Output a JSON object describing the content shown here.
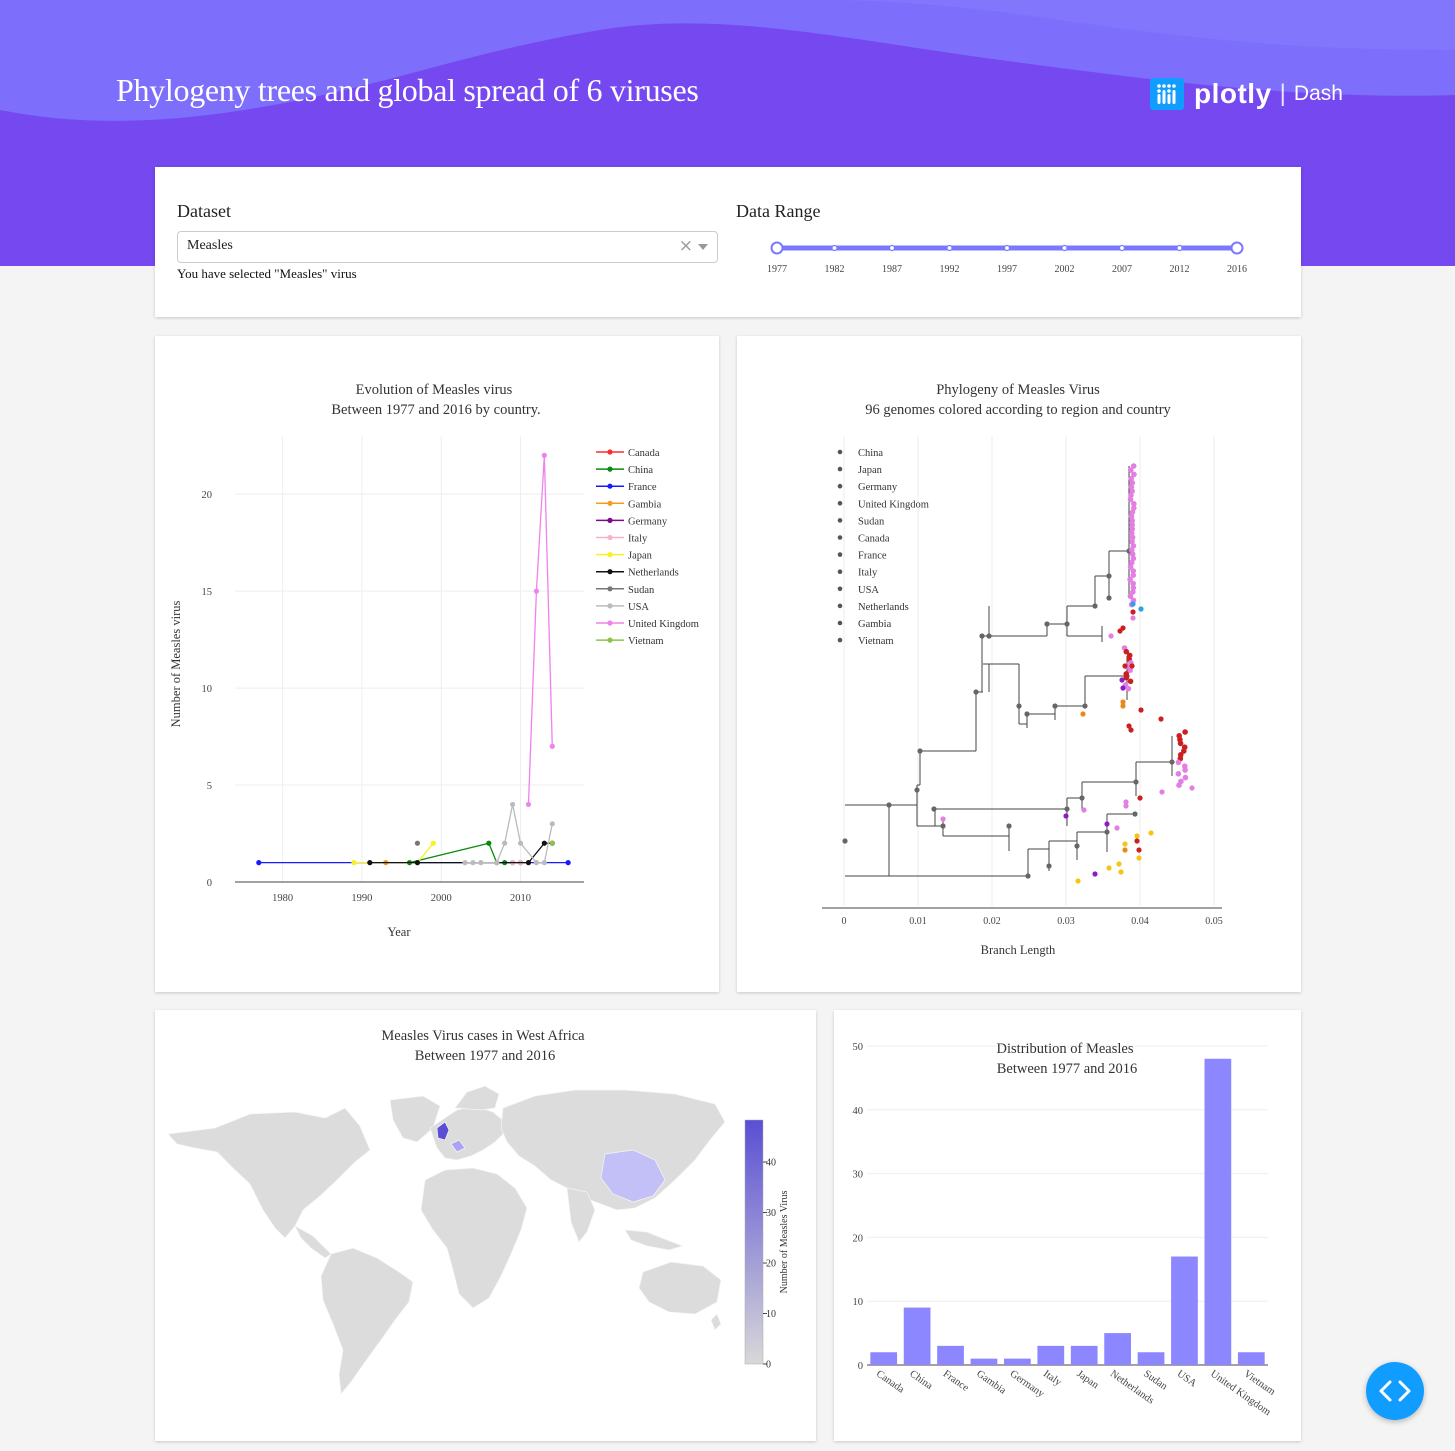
{
  "header": {
    "title": "Phylogeny trees and global spread of 6 viruses",
    "logo_word": "plotly",
    "logo_product": "Dash"
  },
  "controls": {
    "dataset_label": "Dataset",
    "dataset_value": "Measles",
    "selected_note": "You have selected \"Measles\" virus",
    "range_label": "Data Range",
    "range_marks": [
      "1977",
      "1982",
      "1987",
      "1992",
      "1997",
      "2002",
      "2007",
      "2012",
      "2016"
    ],
    "range_value": [
      "1977",
      "2016"
    ]
  },
  "colors": {
    "accent": "#7b78ff",
    "header": "#7548f0",
    "clear_icon": "#999",
    "fab": "#119dff"
  },
  "charts": {
    "evolution": {
      "title_line1": "Evolution of Measles virus",
      "title_line2": "Between 1977 and 2016 by country."
    },
    "phylogeny": {
      "title_line1": "Phylogeny of Measles Virus",
      "title_line2": "96 genomes colored according to region and country"
    },
    "map": {
      "title_line1": "Measles Virus cases in West Africa",
      "title_line2": "Between 1977 and 2016",
      "colorbar_title": "Number of Measles Virus",
      "colorbar_ticks": [
        "0",
        "10",
        "20",
        "30",
        "40"
      ]
    },
    "distribution": {
      "title_line1": "Distribution of Measles",
      "title_line2": "Between 1977 and 2016"
    }
  },
  "chart_data": [
    {
      "type": "line",
      "xlabel": "Year",
      "ylabel": "Number of Measles virus",
      "xlim": [
        1974,
        2018
      ],
      "ylim": [
        0,
        23
      ],
      "xticks": [
        1980,
        1990,
        2000,
        2010
      ],
      "yticks": [
        0,
        5,
        10,
        15,
        20
      ],
      "legend_position": "right",
      "series": [
        {
          "name": "Canada",
          "color": "#ff2a2a",
          "points": []
        },
        {
          "name": "China",
          "color": "#0a8a0a",
          "points": [
            [
              1996,
              1
            ],
            [
              2006,
              2
            ],
            [
              2007,
              1
            ],
            [
              2008,
              1
            ],
            [
              2009,
              1
            ],
            [
              2010,
              1
            ]
          ]
        },
        {
          "name": "France",
          "color": "#1a1aff",
          "points": [
            [
              1977,
              1
            ],
            [
              2016,
              1
            ]
          ]
        },
        {
          "name": "Gambia",
          "color": "#f59c1a",
          "points": [
            [
              1993,
              1
            ]
          ]
        },
        {
          "name": "Germany",
          "color": "#7a0a8a",
          "points": []
        },
        {
          "name": "Italy",
          "color": "#f6b3c6",
          "points": [
            [
              2009,
              1
            ],
            [
              2010,
              1
            ]
          ]
        },
        {
          "name": "Japan",
          "color": "#f8f020",
          "points": [
            [
              1989,
              1
            ],
            [
              1997,
              1
            ],
            [
              1999,
              2
            ]
          ]
        },
        {
          "name": "Netherlands",
          "color": "#111111",
          "points": [
            [
              1991,
              1
            ],
            [
              1997,
              1
            ],
            [
              2011,
              1
            ],
            [
              2013,
              2
            ],
            [
              2014,
              2
            ]
          ]
        },
        {
          "name": "Sudan",
          "color": "#777777",
          "points": [
            [
              1997,
              2
            ]
          ]
        },
        {
          "name": "USA",
          "color": "#bbbbbb",
          "points": [
            [
              2003,
              1
            ],
            [
              2004,
              1
            ],
            [
              2005,
              1
            ],
            [
              2007,
              1
            ],
            [
              2008,
              2
            ],
            [
              2009,
              4
            ],
            [
              2010,
              2
            ],
            [
              2012,
              1
            ],
            [
              2013,
              1
            ],
            [
              2014,
              3
            ]
          ]
        },
        {
          "name": "United Kingdom",
          "color": "#ee82ee",
          "points": [
            [
              2011,
              4
            ],
            [
              2012,
              15
            ],
            [
              2013,
              22
            ],
            [
              2014,
              7
            ]
          ]
        },
        {
          "name": "Vietnam",
          "color": "#8bc34a",
          "points": [
            [
              2014,
              2
            ]
          ]
        }
      ]
    },
    {
      "type": "scatter",
      "xlabel": "Branch Length",
      "ylabel": "",
      "xlim": [
        -0.003,
        0.05
      ],
      "xticks": [
        "0",
        "0.01",
        "0.02",
        "0.03",
        "0.04",
        "0.05"
      ],
      "legend_position": "top-left",
      "legend": [
        "China",
        "Japan",
        "Germany",
        "United Kingdom",
        "Sudan",
        "Canada",
        "France",
        "Italy",
        "USA",
        "Netherlands",
        "Gambia",
        "Vietnam"
      ],
      "legend_color": "#555555"
    },
    {
      "type": "bar",
      "xlabel": "",
      "ylabel": "",
      "ylim": [
        0,
        50
      ],
      "yticks": [
        0,
        10,
        20,
        30,
        40,
        50
      ],
      "categories": [
        "Canada",
        "China",
        "France",
        "Gambia",
        "Germany",
        "Italy",
        "Japan",
        "Netherlands",
        "Sudan",
        "USA",
        "United Kingdom",
        "Vietnam"
      ],
      "values": [
        2,
        9,
        3,
        1,
        1,
        3,
        3,
        5,
        2,
        17,
        48,
        2
      ],
      "bar_color": "#8c87ff"
    }
  ]
}
